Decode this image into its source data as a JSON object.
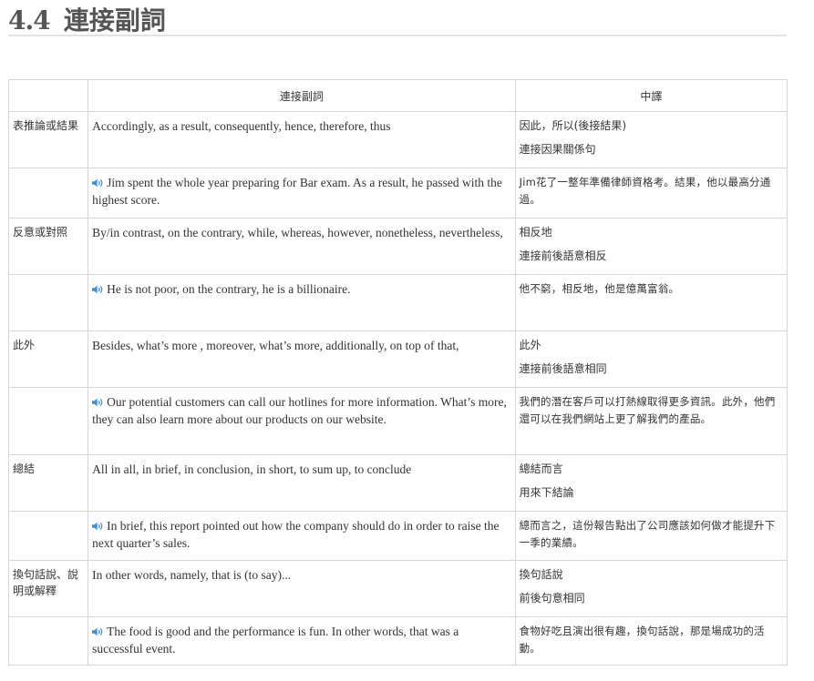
{
  "heading": {
    "number": "4.4",
    "text": "連接副詞"
  },
  "table": {
    "headers": {
      "english": "連接副詞",
      "chinese": "中譯"
    },
    "rows": [
      {
        "category": "表推論或結果",
        "words": "Accordingly, as a result, consequently, hence, therefore, thus",
        "meaning": "因此，所以(後接結果)",
        "usage": "連接因果關係句",
        "example_en": "Jim spent the whole year preparing for Bar exam. As a result, he passed with the highest score.",
        "example_zh": "Jim花了一整年準備律師資格考。結果，他以最高分通過。"
      },
      {
        "category": "反意或對照",
        "words": "By/in contrast, on the contrary, while, whereas, however, nonetheless, nevertheless,",
        "meaning": "相反地",
        "usage": "連接前後語意相反",
        "example_en": "He is not poor, on the contrary, he is a billionaire.",
        "example_zh": "他不窮，相反地，他是億萬富翁。"
      },
      {
        "category": "此外",
        "words": "Besides, what’s more , moreover, what’s more, additionally, on top of that,",
        "meaning": "此外",
        "usage": "連接前後語意相同",
        "example_en": "Our potential customers can call our hotlines for more information. What’s more, they can also learn more about our products on our website.",
        "example_zh": "我們的潛在客戶可以打熱線取得更多資訊。此外，他們還可以在我們網站上更了解我們的產品。"
      },
      {
        "category": "總結",
        "words": "All in all, in brief, in conclusion, in short, to sum up, to conclude",
        "meaning": "總結而言",
        "usage": "用來下結論",
        "example_en": "In brief, this report pointed out how the company should do in order to raise the next quarter’s sales.",
        "example_zh": "總而言之，這份報告點出了公司應該如何做才能提升下一季的業績。"
      },
      {
        "category": "換句話說、說明或解釋",
        "words": "In other words, namely, that is (to say)...",
        "meaning": "換句話說",
        "usage": "前後句意相同",
        "example_en": "The food is good and the performance is fun. In other words, that was a successful event.",
        "example_zh": "食物好吃且演出很有趣，換句話說，那是場成功的活動。"
      }
    ]
  },
  "icons": {
    "audio": "speaker-audio-icon"
  },
  "colors": {
    "audio_icon": "#3b8fd6",
    "border": "#d6d6d6",
    "heading": "#555555"
  }
}
